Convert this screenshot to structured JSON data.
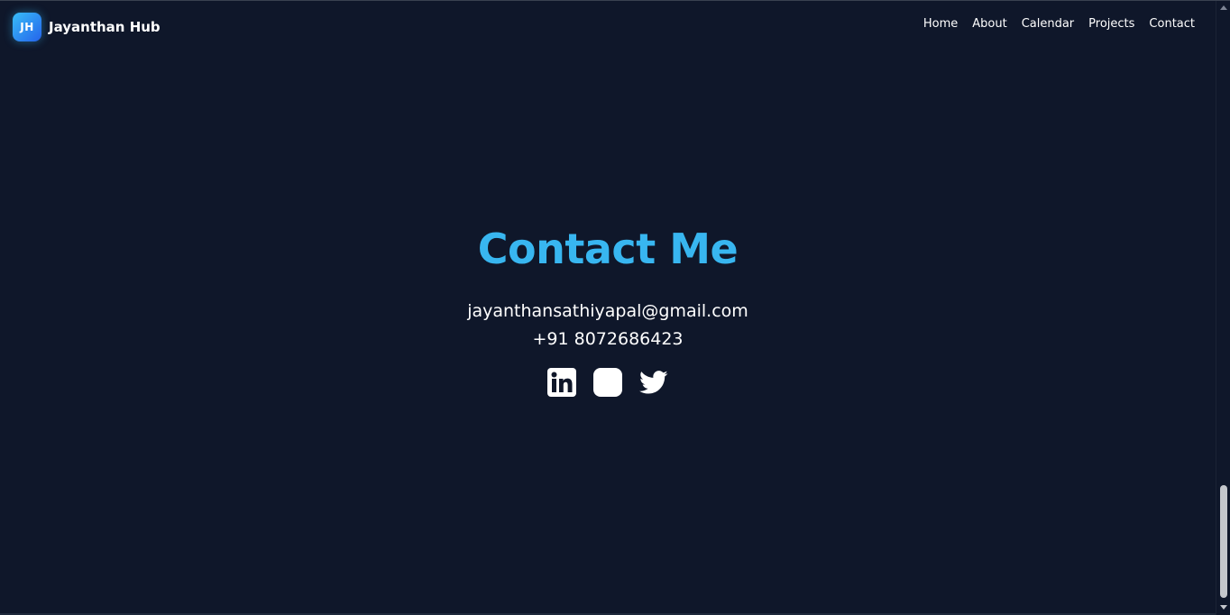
{
  "brand": {
    "logo_initials": "JH",
    "name": "Jayanthan Hub"
  },
  "nav": {
    "items": [
      "Home",
      "About",
      "Calendar",
      "Projects",
      "Contact"
    ]
  },
  "contact": {
    "title": "Contact Me",
    "email": "jayanthansathiyapal@gmail.com",
    "phone": "+91 8072686423",
    "socials": [
      "linkedin-icon",
      "instagram-icon",
      "twitter-icon"
    ]
  },
  "colors": {
    "background": "#0f172a",
    "accent": "#38b6f0",
    "text": "#ffffff"
  }
}
